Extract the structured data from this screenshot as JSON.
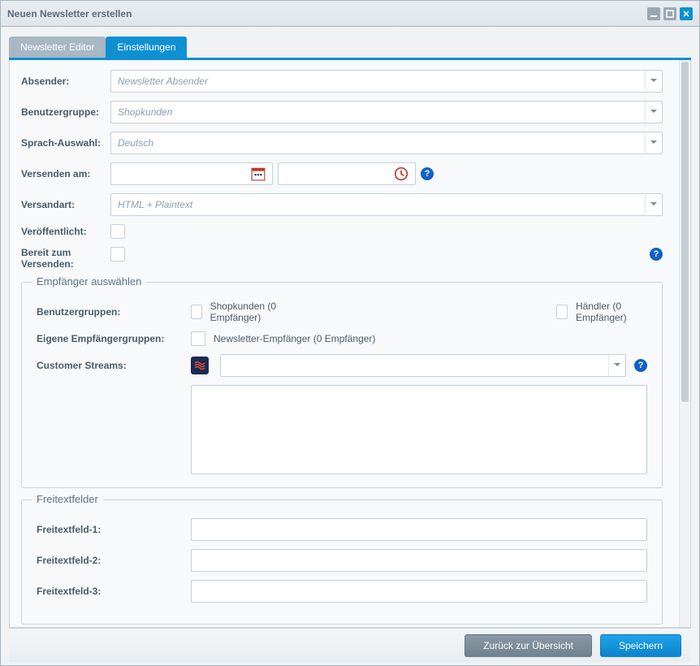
{
  "window": {
    "title": "Neuen Newsletter erstellen"
  },
  "tabs": {
    "editor": "Newsletter Editor",
    "settings": "Einstellungen"
  },
  "labels": {
    "sender": "Absender:",
    "userGroup": "Benutzergruppe:",
    "language": "Sprach-Auswahl:",
    "sendOn": "Versenden am:",
    "deliveryType": "Versandart:",
    "published": "Veröffentlicht:",
    "readyToSend": "Bereit zum Versenden:"
  },
  "fields": {
    "sender": "Newsletter Absender",
    "userGroup": "Shopkunden",
    "language": "Deutsch",
    "date": "",
    "time": "",
    "deliveryType": "HTML + Plaintext",
    "published": false,
    "readyToSend": false
  },
  "recipients": {
    "fieldsetTitle": "Empfänger auswählen",
    "labels": {
      "userGroups": "Benutzergruppen:",
      "ownGroups": "Eigene Empfängergruppen:",
      "customerStreams": "Customer Streams:"
    },
    "options": {
      "shopCustomers": "Shopkunden (0 Empfänger)",
      "dealers": "Händler (0 Empfänger)",
      "newsletterRecipients": "Newsletter-Empfänger (0 Empfänger)"
    },
    "streamValue": ""
  },
  "freeText": {
    "fieldsetTitle": "Freitextfelder",
    "labels": {
      "f1": "Freitextfeld-1:",
      "f2": "Freitextfeld-2:",
      "f3": "Freitextfeld-3:"
    },
    "values": {
      "f1": "",
      "f2": "",
      "f3": ""
    }
  },
  "footer": {
    "back": "Zurück zur Übersicht",
    "save": "Speichern"
  },
  "help": {
    "symbol": "?"
  }
}
